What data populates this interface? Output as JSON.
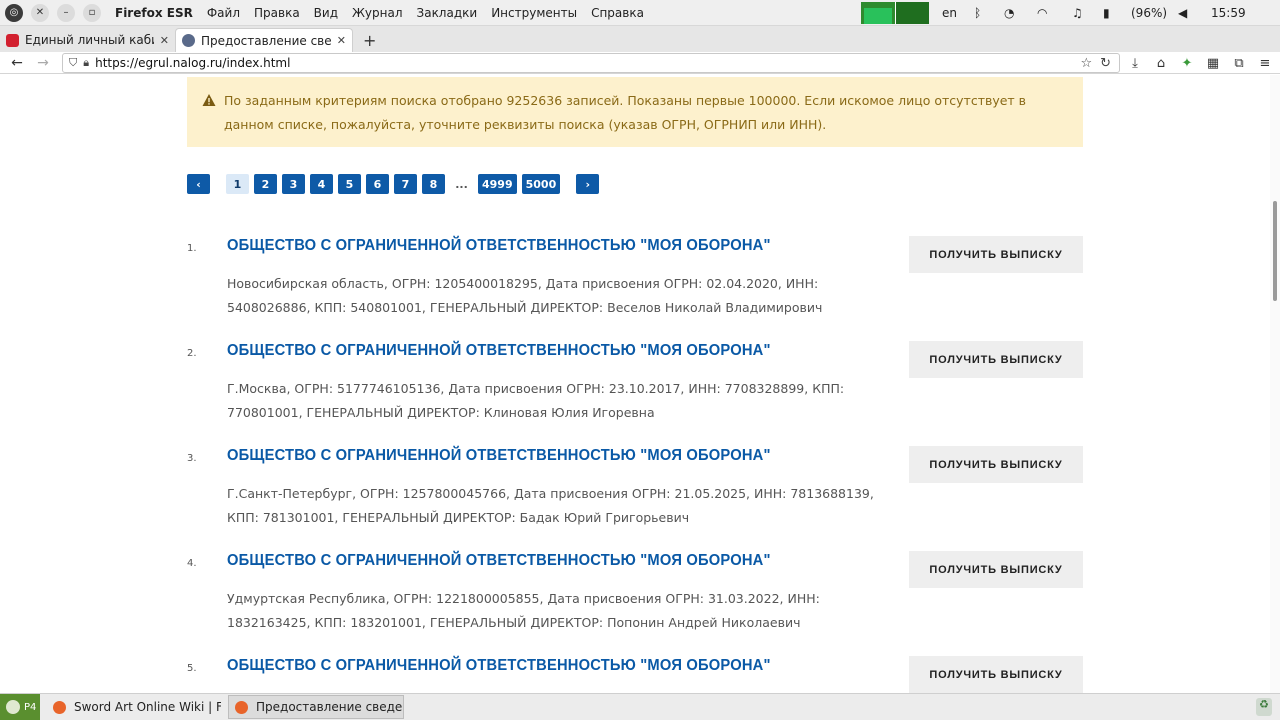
{
  "system_bar": {
    "app_name": "Firefox ESR",
    "menus": [
      "Файл",
      "Правка",
      "Вид",
      "Журнал",
      "Закладки",
      "Инструменты",
      "Справка"
    ],
    "lang": "en",
    "battery": "(96%)",
    "time": "15:59"
  },
  "tabs": [
    {
      "title": "Единый личный кабине",
      "active": false,
      "color": "#d2202f"
    },
    {
      "title": "Предоставление сведен",
      "active": true,
      "color": "#5a6a8a"
    }
  ],
  "nav": {
    "url": "https://egrul.nalog.ru/index.html"
  },
  "notice": {
    "text": "По заданным критериям поиска отобрано 9252636 записей. Показаны первые 100000. Если искомое лицо отсутствует в данном списке, пожалуйста, уточните реквизиты поиска (указав ОГРН, ОГРНИП или ИНН)."
  },
  "pager": {
    "pages": [
      "1",
      "2",
      "3",
      "4",
      "5",
      "6",
      "7",
      "8"
    ],
    "dots": "...",
    "last_pages": [
      "4999",
      "5000"
    ],
    "current": "1"
  },
  "results": [
    {
      "num": "1.",
      "name": "ОБЩЕСТВО С ОГРАНИЧЕННОЙ ОТВЕТСТВЕННОСТЬЮ \"МОЯ ОБОРОНА\"",
      "info": "Новосибирская область, ОГРН: 1205400018295, Дата присвоения ОГРН: 02.04.2020, ИНН: 5408026886, КПП: 540801001, ГЕНЕРАЛЬНЫЙ ДИРЕКТОР: Веселов Николай Владимирович",
      "button": "ПОЛУЧИТЬ ВЫПИСКУ"
    },
    {
      "num": "2.",
      "name": "ОБЩЕСТВО С ОГРАНИЧЕННОЙ ОТВЕТСТВЕННОСТЬЮ \"МОЯ ОБОРОНА\"",
      "info": "Г.Москва, ОГРН: 5177746105136, Дата присвоения ОГРН: 23.10.2017, ИНН: 7708328899, КПП: 770801001, ГЕНЕРАЛЬНЫЙ ДИРЕКТОР: Клиновая Юлия Игоревна",
      "button": "ПОЛУЧИТЬ ВЫПИСКУ"
    },
    {
      "num": "3.",
      "name": "ОБЩЕСТВО С ОГРАНИЧЕННОЙ ОТВЕТСТВЕННОСТЬЮ \"МОЯ ОБОРОНА\"",
      "info": "Г.Санкт-Петербург, ОГРН: 1257800045766, Дата присвоения ОГРН: 21.05.2025, ИНН: 7813688139, КПП: 781301001, ГЕНЕРАЛЬНЫЙ ДИРЕКТОР: Бадак Юрий Григорьевич",
      "button": "ПОЛУЧИТЬ ВЫПИСКУ"
    },
    {
      "num": "4.",
      "name": "ОБЩЕСТВО С ОГРАНИЧЕННОЙ ОТВЕТСТВЕННОСТЬЮ \"МОЯ ОБОРОНА\"",
      "info": "Удмуртская Республика, ОГРН: 1221800005855, Дата присвоения ОГРН: 31.03.2022, ИНН: 1832163425, КПП: 183201001, ГЕНЕРАЛЬНЫЙ ДИРЕКТОР: Попонин Андрей Николаевич",
      "button": "ПОЛУЧИТЬ ВЫПИСКУ"
    },
    {
      "num": "5.",
      "name": "ОБЩЕСТВО С ОГРАНИЧЕННОЙ ОТВЕТСТВЕННОСТЬЮ \"МОЯ ОБОРОНА\"",
      "info": "",
      "button": "ПОЛУЧИТЬ ВЫПИСКУ"
    }
  ],
  "taskbar": {
    "start_label": "P4",
    "tasks": [
      {
        "title": "Sword Art Online Wiki | F...",
        "active": false
      },
      {
        "title": "Предоставление сведен...",
        "active": true
      }
    ]
  }
}
